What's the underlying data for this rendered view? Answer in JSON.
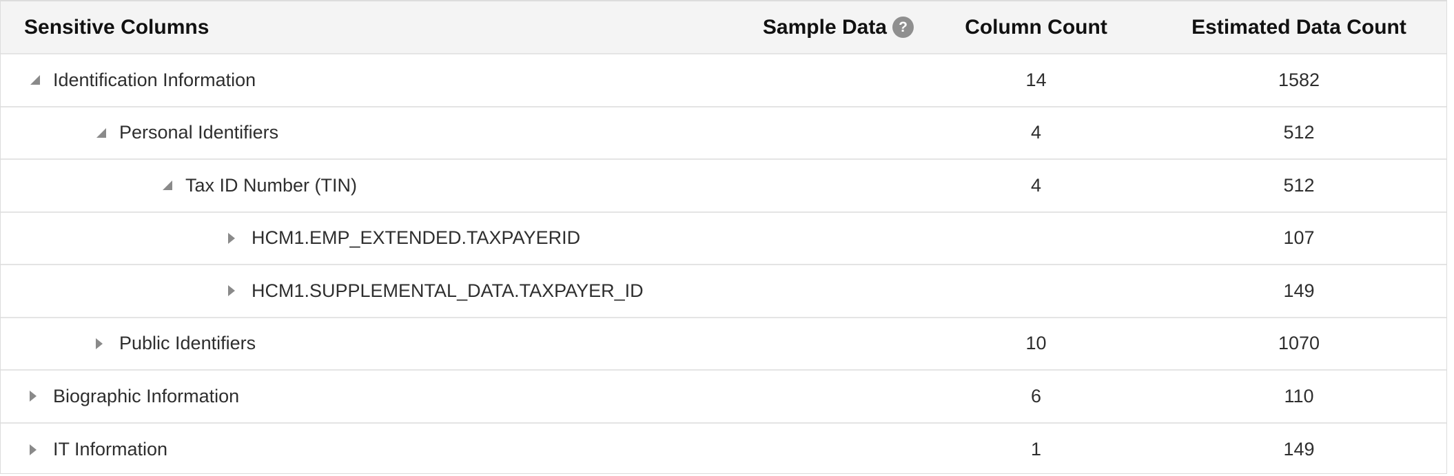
{
  "columns": {
    "name": "Sensitive Columns",
    "sample": "Sample Data",
    "column_count": "Column Count",
    "estimated": "Estimated Data Count"
  },
  "rows": [
    {
      "label": "Identification Information",
      "level": 0,
      "expanded": true,
      "column_count": "14",
      "estimated": "1582"
    },
    {
      "label": "Personal Identifiers",
      "level": 1,
      "expanded": true,
      "column_count": "4",
      "estimated": "512"
    },
    {
      "label": "Tax ID Number (TIN)",
      "level": 2,
      "expanded": true,
      "column_count": "4",
      "estimated": "512"
    },
    {
      "label": "HCM1.EMP_EXTENDED.TAXPAYERID",
      "level": 3,
      "expanded": false,
      "column_count": "",
      "estimated": "107"
    },
    {
      "label": "HCM1.SUPPLEMENTAL_DATA.TAXPAYER_ID",
      "level": 3,
      "expanded": false,
      "column_count": "",
      "estimated": "149"
    },
    {
      "label": "Public Identifiers",
      "level": 1,
      "expanded": false,
      "column_count": "10",
      "estimated": "1070"
    },
    {
      "label": "Biographic Information",
      "level": 0,
      "expanded": false,
      "column_count": "6",
      "estimated": "110"
    },
    {
      "label": "IT Information",
      "level": 0,
      "expanded": false,
      "column_count": "1",
      "estimated": "149"
    }
  ],
  "icons": {
    "help": "question-circle-icon",
    "expanded": "triangle-down-icon",
    "collapsed": "triangle-right-icon"
  }
}
